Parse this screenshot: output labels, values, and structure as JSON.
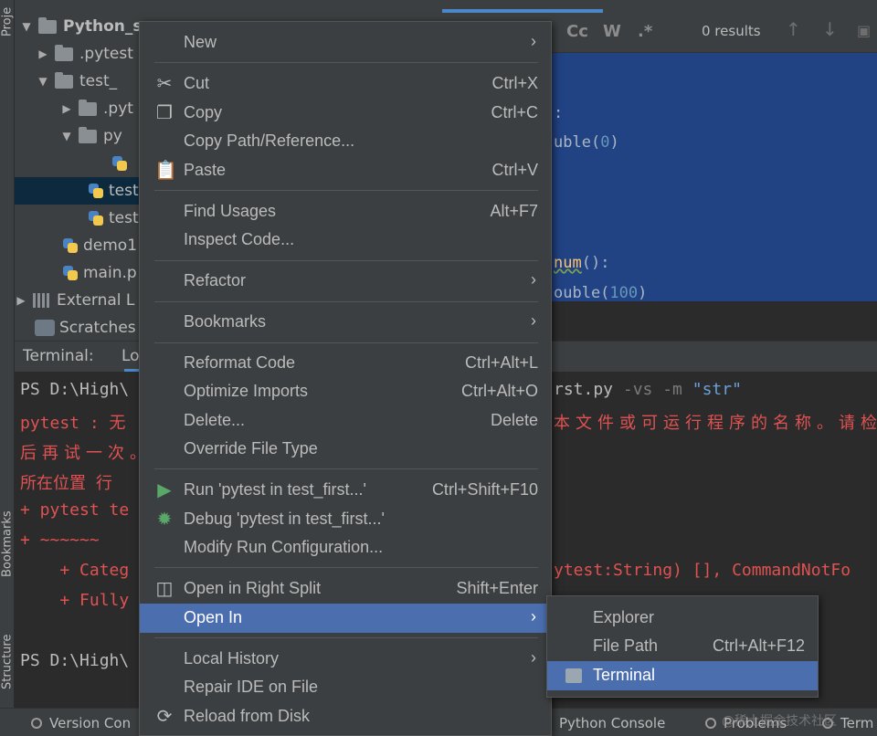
{
  "tool_strip": {
    "project_tab": "Proje",
    "bookmarks_tab": "Bookmarks",
    "structure_tab": "Structure"
  },
  "project": {
    "items": [
      {
        "label": "Python_se"
      },
      {
        "label": ".pytest"
      },
      {
        "label": "test_"
      },
      {
        "label": ".pyt"
      },
      {
        "label": "py"
      },
      {
        "label": ""
      },
      {
        "label": "test"
      },
      {
        "label": "test"
      },
      {
        "label": "demo1"
      },
      {
        "label": "main.p"
      },
      {
        "label": "External L"
      },
      {
        "label": "Scratches"
      }
    ]
  },
  "find_bar": {
    "case_btn": "Cc",
    "word_btn": "W",
    "regex_btn": ".*",
    "results": "0 results"
  },
  "code": {
    "line1": ":",
    "line2_pre": "uble(",
    "line2_num": "0",
    "line2_post": ")",
    "line3_fn": "num",
    "line3_post": "():",
    "line4_pre": "ouble(",
    "line4_num": "100",
    "line4_post": ")"
  },
  "terminal": {
    "header_label": "Terminal:",
    "header_tab": "Lo",
    "lines": {
      "l1_prompt": "PS D:\\High\\",
      "l1_cmd": "rst.py",
      "l1_flags": " -vs -m ",
      "l1_str": "\"str\"",
      "l2_left": "pytest : 无",
      "l2_right": "本文件或可运行程序的名称。请检",
      "l3": "后再试一次。",
      "l4": "所在位置 行",
      "l5": "+ pytest te",
      "l6": "+ ~~~~~~",
      "l7_left": "    + Categ",
      "l7_right": "ytest:String) [], CommandNotFo",
      "l8": "    + Fully",
      "l9": "PS D:\\High\\"
    }
  },
  "status_bar": {
    "version_control": "Version Con",
    "python_console": "Python Console",
    "problems": "Problems",
    "terminal": "Term",
    "watermark": "@稀土掘金技术社区"
  },
  "context_menu": {
    "new": "New",
    "cut": "Cut",
    "cut_sc": "Ctrl+X",
    "copy": "Copy",
    "copy_sc": "Ctrl+C",
    "copy_path": "Copy Path/Reference...",
    "paste": "Paste",
    "paste_sc": "Ctrl+V",
    "find_usages": "Find Usages",
    "find_usages_sc": "Alt+F7",
    "inspect_code": "Inspect Code...",
    "refactor": "Refactor",
    "bookmarks": "Bookmarks",
    "reformat_code": "Reformat Code",
    "reformat_code_sc": "Ctrl+Alt+L",
    "optimize_imports": "Optimize Imports",
    "optimize_imports_sc": "Ctrl+Alt+O",
    "delete": "Delete...",
    "delete_sc": "Delete",
    "override_file_type": "Override File Type",
    "run": "Run 'pytest in test_first...'",
    "run_sc": "Ctrl+Shift+F10",
    "debug": "Debug 'pytest in test_first...'",
    "modify_run": "Modify Run Configuration...",
    "open_right_split": "Open in Right Split",
    "open_right_split_sc": "Shift+Enter",
    "open_in": "Open In",
    "local_history": "Local History",
    "repair_ide": "Repair IDE on File",
    "reload_disk": "Reload from Disk"
  },
  "submenu": {
    "explorer": "Explorer",
    "file_path": "File Path",
    "file_path_sc": "Ctrl+Alt+F12",
    "terminal": "Terminal"
  },
  "colors": {
    "menu_bg": "#3c3f41",
    "highlight": "#4b6eaf",
    "selection": "#214283",
    "error_text": "#e05252"
  }
}
